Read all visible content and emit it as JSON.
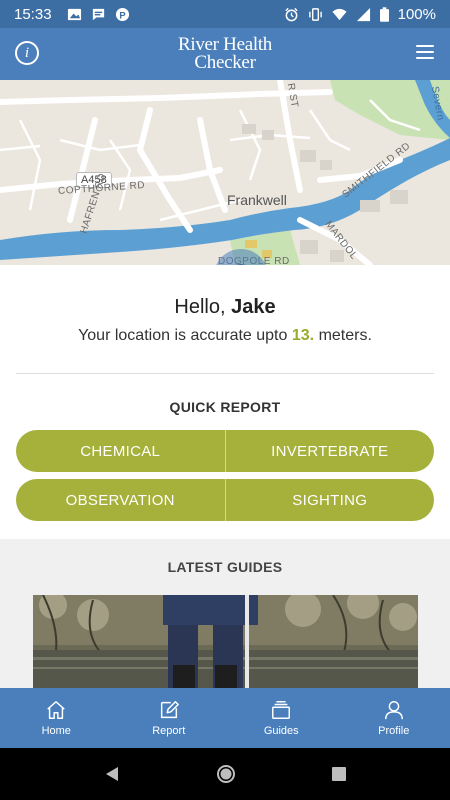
{
  "status_bar": {
    "time": "15:33",
    "battery": "100%",
    "left_icons": [
      "image-icon",
      "message-icon",
      "p-icon"
    ],
    "right_icons": [
      "alarm-icon",
      "vibrate-icon",
      "wifi-icon",
      "signal-icon",
      "battery-icon"
    ]
  },
  "header": {
    "logo_line1": "River Health",
    "logo_line2": "Checker",
    "info_icon": "i",
    "colors": {
      "bar": "#4a7fbc",
      "status": "#3c6ea3"
    }
  },
  "map": {
    "town": "Frankwell",
    "road_badge": "A458",
    "labels": {
      "hafren": "HAFREN RD",
      "copthorne": "COPTHORNE RD",
      "smithfield": "SMITHFIELD RD",
      "mardol": "MARDOL",
      "st": "R ST",
      "severn": "Severn",
      "dogpole": "DOGPOLE RD"
    }
  },
  "greeting": {
    "hello_prefix": "Hello,",
    "name": "Jake",
    "accuracy_prefix": "Your location is accurate upto",
    "accuracy_value": "13.",
    "accuracy_suffix": "meters."
  },
  "quick_report": {
    "title": "QUICK REPORT",
    "buttons": [
      "CHEMICAL",
      "INVERTEBRATE",
      "OBSERVATION",
      "SIGHTING"
    ],
    "color": "#a5b13b"
  },
  "latest_guides": {
    "title": "LATEST GUIDES"
  },
  "bottom_nav": {
    "items": [
      {
        "label": "Home",
        "icon": "home-icon"
      },
      {
        "label": "Report",
        "icon": "edit-icon"
      },
      {
        "label": "Guides",
        "icon": "layers-icon"
      },
      {
        "label": "Profile",
        "icon": "person-icon"
      }
    ]
  },
  "system_nav": {
    "icons": [
      "back-icon",
      "home-circle-icon",
      "recents-icon"
    ]
  }
}
